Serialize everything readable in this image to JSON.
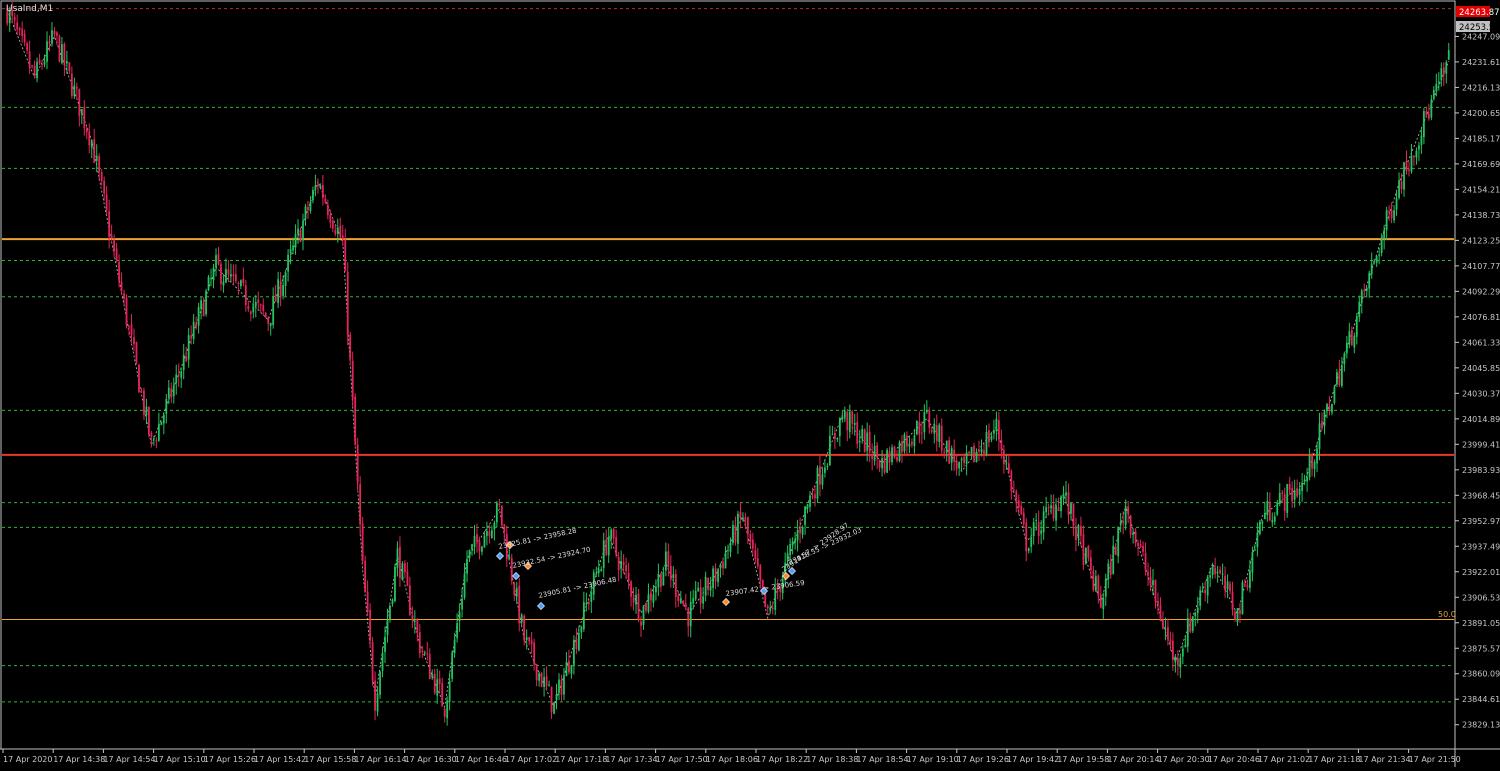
{
  "window": {
    "title": "UsaInd,M1"
  },
  "colors": {
    "background": "#000000",
    "frame": "#c0c0c0",
    "bull": "#22c55e",
    "bear": "#e4245a",
    "grid_dashed": "#2fb52f",
    "orange_line": "#f0a030",
    "red_line": "#e83a2a",
    "zigzag": "#ffffff",
    "price_tag": "#e40000",
    "axis_text": "#c8c8c8",
    "fib_label": "#d7a640"
  },
  "price_tags": {
    "current": "24263.87",
    "second": "24253.55"
  },
  "fib_level_label": "50.0",
  "trade_labels": [
    {
      "text": "23925.81 -> 23958.28"
    },
    {
      "text": "23932.54 -> 23924.70"
    },
    {
      "text": "23905.81 -> 23906.48"
    },
    {
      "text": "23907.42 -> 23906.59"
    },
    {
      "text": "23914.57 -> 23928.97"
    },
    {
      "text": "23918.55 -> 23932.03"
    }
  ],
  "chart_data": {
    "type": "candlestick",
    "symbol": "UsaInd",
    "timeframe": "M1",
    "y_range": [
      23815,
      24268
    ],
    "y_ticks": [
      "24247.09",
      "24231.61",
      "24216.13",
      "24200.65",
      "24185.17",
      "24169.69",
      "24154.21",
      "24138.73",
      "24123.25",
      "24107.77",
      "24092.29",
      "24076.81",
      "24061.33",
      "24045.85",
      "24030.37",
      "24014.89",
      "23999.41",
      "23983.93",
      "23968.45",
      "23952.97",
      "23937.49",
      "23922.01",
      "23906.53",
      "23891.05",
      "23875.57",
      "23860.09",
      "23844.61",
      "23829.13"
    ],
    "x_ticks": [
      "17 Apr 2020",
      "17 Apr 14:38",
      "17 Apr 14:54",
      "17 Apr 15:10",
      "17 Apr 15:26",
      "17 Apr 15:42",
      "17 Apr 15:58",
      "17 Apr 16:14",
      "17 Apr 16:30",
      "17 Apr 16:46",
      "17 Apr 17:02",
      "17 Apr 17:18",
      "17 Apr 17:34",
      "17 Apr 17:50",
      "17 Apr 18:06",
      "17 Apr 18:22",
      "17 Apr 18:38",
      "17 Apr 18:54",
      "17 Apr 19:10",
      "17 Apr 19:26",
      "17 Apr 19:42",
      "17 Apr 19:58",
      "17 Apr 20:14",
      "17 Apr 20:30",
      "17 Apr 20:46",
      "17 Apr 21:02",
      "17 Apr 21:18",
      "17 Apr 21:34",
      "17 Apr 21:50"
    ],
    "horizontal_levels": [
      {
        "price": 24264.0,
        "style": "dashed",
        "color": "red_dashed"
      },
      {
        "price": 24204.0,
        "style": "dashed",
        "color": "green"
      },
      {
        "price": 24167.0,
        "style": "dashed",
        "color": "green"
      },
      {
        "price": 24124.0,
        "style": "solid",
        "color": "orange"
      },
      {
        "price": 24111.0,
        "style": "dashed",
        "color": "green"
      },
      {
        "price": 24089.0,
        "style": "dashed",
        "color": "green"
      },
      {
        "price": 24020.0,
        "style": "dashed",
        "color": "green"
      },
      {
        "price": 23993.0,
        "style": "solid",
        "color": "red"
      },
      {
        "price": 23964.0,
        "style": "dashed",
        "color": "green"
      },
      {
        "price": 23949.0,
        "style": "dashed",
        "color": "green"
      },
      {
        "price": 23893.0,
        "style": "solid",
        "color": "orange"
      },
      {
        "price": 23865.0,
        "style": "dashed",
        "color": "green"
      },
      {
        "price": 23843.0,
        "style": "dashed",
        "color": "green"
      }
    ],
    "zigzag_points": [
      [
        0,
        24263
      ],
      [
        11,
        24222
      ],
      [
        19,
        24247
      ],
      [
        34,
        24184
      ],
      [
        58,
        23999
      ],
      [
        70,
        24046
      ],
      [
        84,
        24107
      ],
      [
        105,
        24075
      ],
      [
        125,
        24159
      ],
      [
        135,
        24122
      ],
      [
        143,
        23923
      ],
      [
        148,
        23845
      ],
      [
        157,
        23932
      ],
      [
        166,
        23878
      ],
      [
        176,
        23840
      ],
      [
        185,
        23930
      ],
      [
        198,
        23960
      ],
      [
        208,
        23881
      ],
      [
        220,
        23840
      ],
      [
        242,
        23944
      ],
      [
        255,
        23897
      ],
      [
        265,
        23927
      ],
      [
        274,
        23896
      ],
      [
        285,
        23920
      ],
      [
        296,
        23956
      ],
      [
        306,
        23894
      ],
      [
        322,
        23963
      ],
      [
        336,
        24017
      ],
      [
        352,
        23988
      ],
      [
        370,
        24015
      ],
      [
        384,
        23983
      ],
      [
        398,
        24010
      ],
      [
        410,
        23940
      ],
      [
        425,
        23969
      ],
      [
        440,
        23903
      ],
      [
        450,
        23962
      ],
      [
        470,
        23867
      ],
      [
        485,
        23927
      ],
      [
        495,
        23896
      ],
      [
        505,
        23956
      ],
      [
        522,
        23976
      ],
      [
        560,
        24158
      ],
      [
        580,
        24232
      ]
    ]
  }
}
